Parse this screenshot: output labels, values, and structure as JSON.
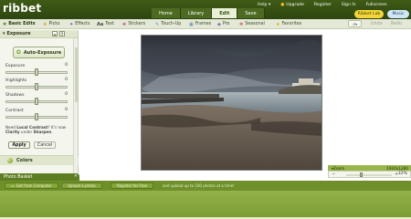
{
  "app": {
    "logo": "ribbet"
  },
  "top_nav": {
    "tabs": [
      "Home",
      "Library",
      "Edit",
      "Save"
    ],
    "active": "Edit"
  },
  "top_links": {
    "help": "Help",
    "upgrade": "Upgrade",
    "register": "Register",
    "sign_in": "Sign In",
    "fullscreen": "Fullscreen"
  },
  "pills": {
    "lab": "Ribbet Lab",
    "music": "Music"
  },
  "tool_tabs": {
    "basic_edits": "Basic Edits",
    "picks": "Picks",
    "effects": "Effects",
    "text": "Text",
    "stickers": "Stickers",
    "touch_up": "Touch-Up",
    "frames": "Frames",
    "pro": "Pro",
    "seasonal": "Seasonal",
    "favorites": "Favorites",
    "undo": "Undo",
    "redo": "Redo"
  },
  "panel": {
    "title": "Exposure",
    "auto_exposure": "Auto-Exposure",
    "sliders": [
      {
        "label": "Exposure",
        "value": "0",
        "level": 0.5
      },
      {
        "label": "Highlights",
        "value": "0",
        "level": 0.5
      },
      {
        "label": "Shadows",
        "value": "0",
        "level": 0.5
      },
      {
        "label": "Contrast",
        "value": "0",
        "level": 0.5
      }
    ],
    "note_part1": "Need ",
    "note_bold1": "Local Contrast",
    "note_part2": "? It's now",
    "note_bold2": "Clarity",
    "note_part3": " under ",
    "note_bold3": "Sharpen",
    "note_part4": ".",
    "apply": "Apply",
    "cancel": "Cancel",
    "colors": "Colors"
  },
  "zoom": {
    "label": "Zoom",
    "dimensions": "1920x1280",
    "percent": "32%",
    "level": 0.32
  },
  "basket": {
    "title": "Photo Basket",
    "get_from_computer": "Get from Computer",
    "upload": "Upload a photo",
    "register": "Register for Free",
    "register_note": "and upload up to 100 photos at a time!"
  },
  "colors": {
    "top_bar": "#3f5b16",
    "accent_yellow": "#f5d63a",
    "basket_green": "#6e8f2a"
  }
}
